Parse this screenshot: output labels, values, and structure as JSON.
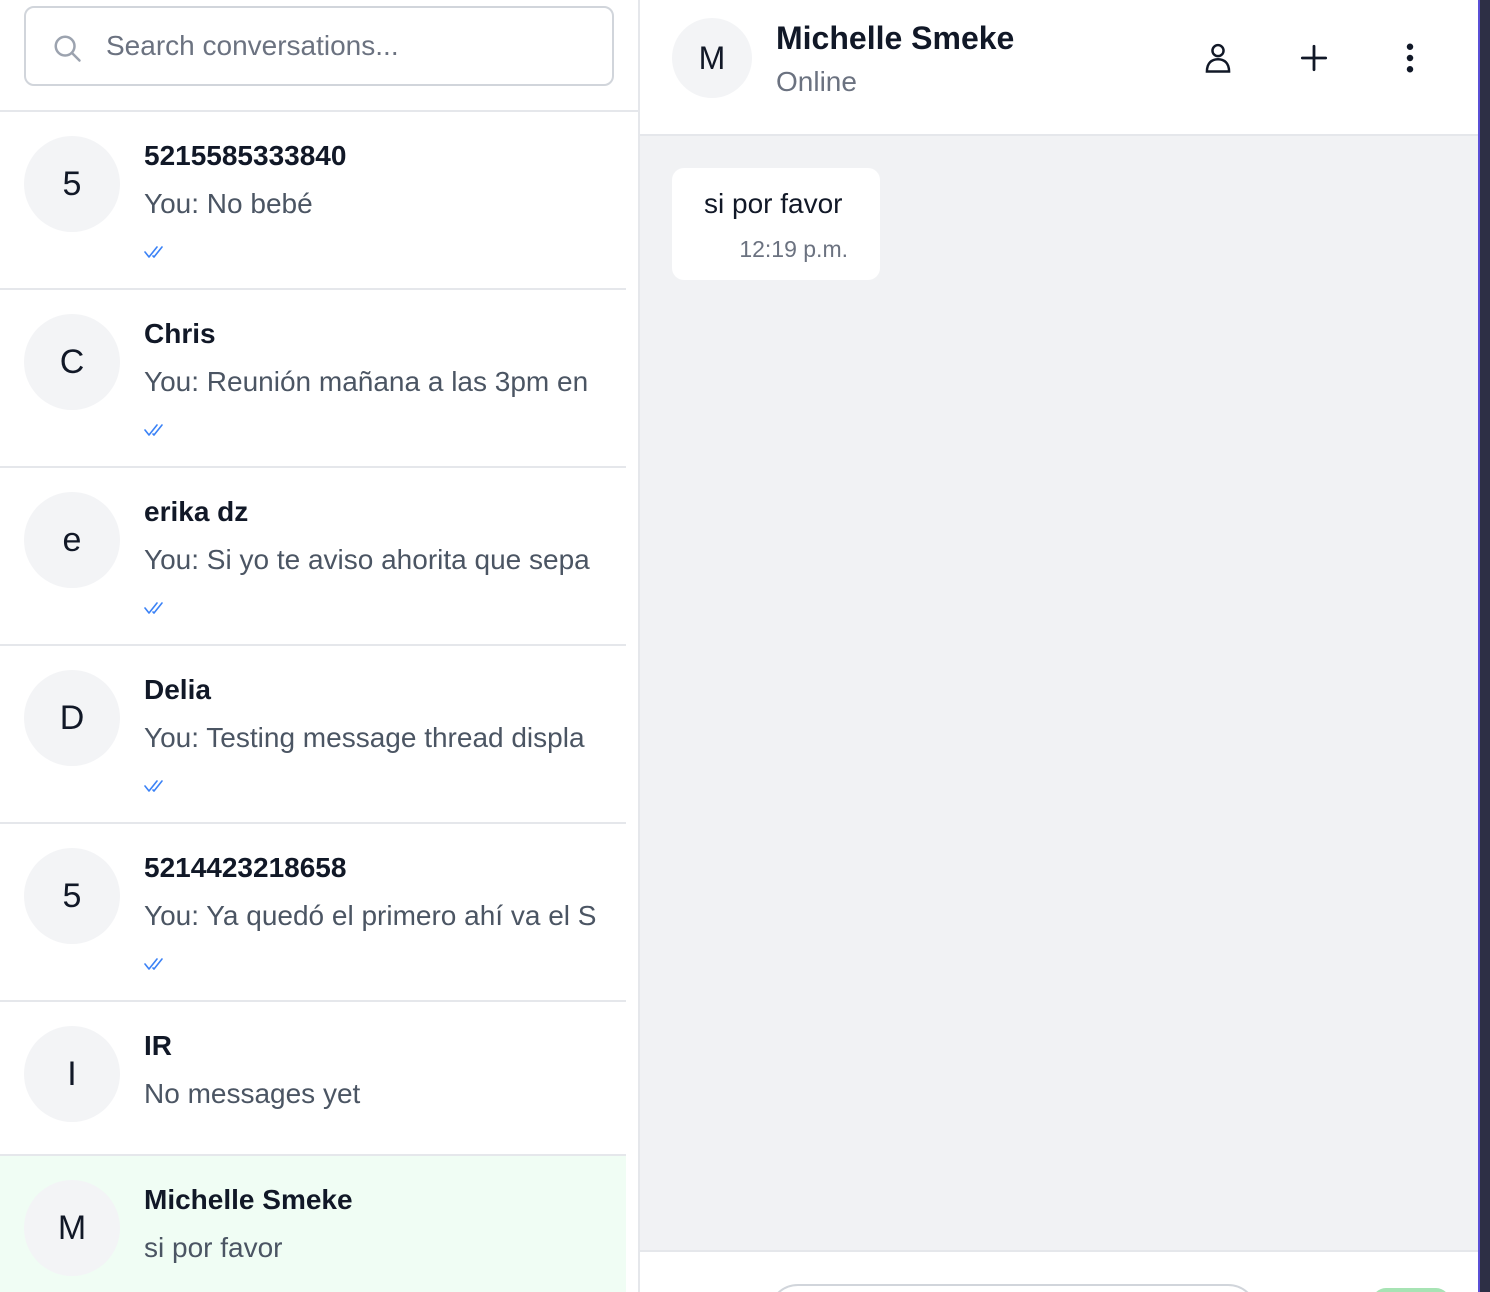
{
  "search": {
    "placeholder": "Search conversations..."
  },
  "conversations": [
    {
      "initial": "5",
      "name": "5215585333840",
      "preview": "You: No bebé",
      "read": true
    },
    {
      "initial": "C",
      "name": "Chris",
      "preview": "You: Reunión mañana a las 3pm en",
      "read": true
    },
    {
      "initial": "e",
      "name": "erika dz",
      "preview": "You: Si yo te aviso ahorita que sepa",
      "read": true
    },
    {
      "initial": "D",
      "name": "Delia",
      "preview": "You: Testing message thread displa",
      "read": true
    },
    {
      "initial": "5",
      "name": "5214423218658",
      "preview": "You: Ya quedó el primero ahí va el S",
      "read": true
    },
    {
      "initial": "I",
      "name": "IR",
      "preview": "No messages yet",
      "read": false
    },
    {
      "initial": "M",
      "name": "Michelle Smeke",
      "preview": "si por favor",
      "read": false,
      "active": true
    }
  ],
  "chat": {
    "contact": {
      "initial": "M",
      "name": "Michelle Smeke",
      "status": "Online"
    },
    "messages": [
      {
        "text": "si por favor",
        "time": "12:19 p.m."
      }
    ]
  },
  "icons": {
    "search": "search-icon",
    "read_receipt": "double-check-icon",
    "contact_info": "user-icon",
    "add": "plus-icon",
    "more": "more-vertical-icon"
  },
  "colors": {
    "active_row": "#f0fdf4",
    "read_receipt": "#3b82f6",
    "chat_bg": "#f1f2f4",
    "send_button": "#a7e3b4"
  }
}
